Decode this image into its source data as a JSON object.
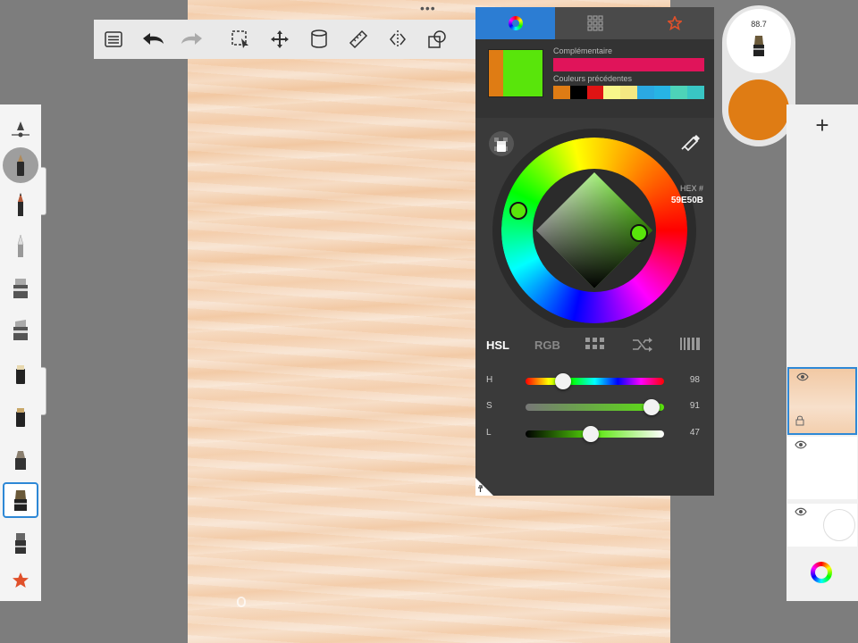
{
  "canvas": {
    "more_glyph": "•••"
  },
  "toolbar": {
    "icons": [
      "list-icon",
      "undo-icon",
      "redo-icon",
      "selection-icon",
      "transform-icon",
      "fill-icon",
      "ruler-icon",
      "symmetry-icon",
      "shapes-icon"
    ]
  },
  "brushes": {
    "icons": [
      "brush-properties-icon",
      "airbrush-icon",
      "pencil-icon",
      "ballpoint-pen-icon",
      "marker-icon",
      "chisel-marker-icon",
      "paintbrush-icon",
      "flat-brush-icon",
      "smudge-icon",
      "wide-brush-icon",
      "eraser-icon",
      "favorites-star-icon"
    ],
    "active_index": 9
  },
  "color_panel": {
    "tabs": [
      "color-wheel-tab",
      "color-sets-tab",
      "favorites-tab"
    ],
    "active_tab": 0,
    "current_color": "#59E50B",
    "previous_color": "#DF7C14",
    "complementary_label": "Complémentaire",
    "complementary_color": "#E0145A",
    "previous_colors_label": "Couleurs précédentes",
    "previous_colors": [
      "#DF7C14",
      "#000000",
      "#E01414",
      "#F7F78A",
      "#F5E882",
      "#2BA9E2",
      "#27B4E4",
      "#4DD3B8",
      "#39C6C4"
    ],
    "hex_label": "HEX #",
    "hex_value": "59E50B",
    "modes": [
      "HSL",
      "RGB"
    ],
    "active_mode": "HSL",
    "sliders": [
      {
        "label": "H",
        "value": "98",
        "fraction": 0.27
      },
      {
        "label": "S",
        "value": "91",
        "fraction": 0.91
      },
      {
        "label": "L",
        "value": "47",
        "fraction": 0.47
      }
    ]
  },
  "puck": {
    "brush_size": "88.7",
    "color": "#DF7C14"
  },
  "layers": {
    "add_label": "+",
    "count": 3
  }
}
